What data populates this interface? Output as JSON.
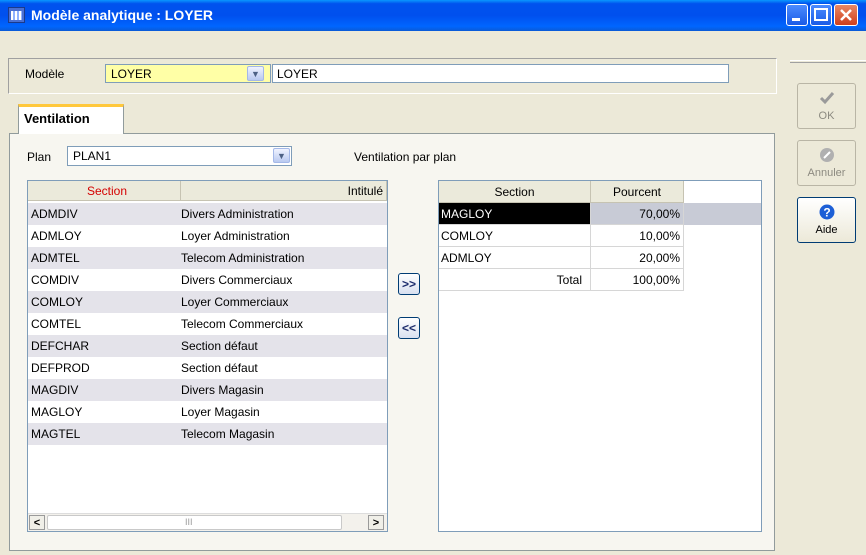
{
  "window": {
    "title": "Modèle analytique : LOYER"
  },
  "model": {
    "label": "Modèle",
    "code": "LOYER",
    "description": "LOYER"
  },
  "tabs": [
    {
      "label": "Ventilation"
    }
  ],
  "plan": {
    "label": "Plan",
    "value": "PLAN1",
    "ventilation_label": "Ventilation par plan"
  },
  "left_grid": {
    "headers": [
      "Section",
      "Intitulé"
    ],
    "header_section_color": "#d40000",
    "rows": [
      {
        "section": "ADMDIV",
        "label": "Divers Administration"
      },
      {
        "section": "ADMLOY",
        "label": "Loyer Administration"
      },
      {
        "section": "ADMTEL",
        "label": "Telecom Administration"
      },
      {
        "section": "COMDIV",
        "label": "Divers Commerciaux"
      },
      {
        "section": "COMLOY",
        "label": "Loyer Commerciaux"
      },
      {
        "section": "COMTEL",
        "label": "Telecom Commerciaux"
      },
      {
        "section": "DEFCHAR",
        "label": "Section défaut"
      },
      {
        "section": "DEFPROD",
        "label": "Section défaut"
      },
      {
        "section": "MAGDIV",
        "label": "Divers Magasin"
      },
      {
        "section": "MAGLOY",
        "label": "Loyer Magasin"
      },
      {
        "section": "MAGTEL",
        "label": "Telecom Magasin"
      }
    ]
  },
  "move_buttons": {
    "add": ">>",
    "remove": "<<"
  },
  "right_grid": {
    "headers": [
      "Section",
      "Pourcent"
    ],
    "rows": [
      {
        "section": "MAGLOY",
        "percent": "70,00%"
      },
      {
        "section": "COMLOY",
        "percent": "10,00%"
      },
      {
        "section": "ADMLOY",
        "percent": "20,00%"
      }
    ],
    "total_label": "Total",
    "total_value": "100,00%"
  },
  "side_buttons": {
    "ok": "OK",
    "cancel": "Annuler",
    "help": "Aide"
  },
  "icons": {
    "app": "app-window-icon",
    "ok": "checkmark-icon",
    "cancel": "cancel-icon",
    "help": "help-icon"
  }
}
